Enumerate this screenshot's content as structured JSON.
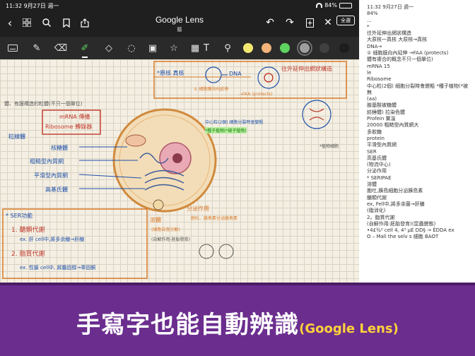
{
  "status_bar": {
    "time": "11:32  9月27日 週一",
    "battery": "84%",
    "battery_level": 0.84
  },
  "header": {
    "title": "Google Lens",
    "subtitle": "聽",
    "all_button": "全選"
  },
  "nav_icons": [
    "chevron-left-icon",
    "grid-icon",
    "search-icon",
    "bookmark-icon",
    "share-icon"
  ],
  "right_icons": [
    "undo-icon",
    "redo-icon",
    "add-page-icon",
    "close-icon",
    "more-icon"
  ],
  "tools": [
    "pen",
    "eraser",
    "highlighter",
    "shapes",
    "lasso",
    "image",
    "sticker",
    "text",
    "laser"
  ],
  "colors": {
    "swatches": [
      "#f3e970",
      "#f2b27a",
      "#5fd35f",
      "#9e9e9e",
      "#404040",
      "#1d1d1d"
    ],
    "selected": "#9e9e9e",
    "banner": "#6b2d8e",
    "accent": "#ffd23a"
  },
  "notes": {
    "top_title": "*原核  真核",
    "dna": "DNA",
    "red_title": "往外延伸出網狀構造",
    "sub_left": "① 細胞膜向內延伸",
    "sub_right": "→FAA (protects)",
    "left_heading": "體、有膜構造的粒體(不只一個單位)",
    "mrna": "mRNA 傳播",
    "ribosome": "Ribosome  轉錄器",
    "nucleus_heading": "中心粒(2個) 細胞分裂時會變粗",
    "green_line": "*種子植物(*被子植物)",
    "plant": "*植物細胞",
    "mitochondria_label": "粒線體",
    "ribosome_label": "核糖體",
    "er_label": "粗糙型內質網",
    "smooth_er_label": "平滑型內質網",
    "golgi_label": "高基氏體",
    "lysosome_label": "溶體",
    "phago": "分泌作用",
    "secrete_note": "胞吐、胰島素分泌胰島素",
    "ser_title": "* SER功能",
    "ser_1": "1. 醣類代謝",
    "ser_1_ex": "ex. 肝 cell中,將多余醣→肝醣",
    "ser_2": "2. 脂質代謝",
    "ser_2_ex": "ex. 性腺 cell中, 將膽固醇→睪固酮",
    "bottom_note": "(自解作用-胚胎發育)",
    "bottom_note2": "(細胞自我分解)"
  },
  "ocr": {
    "lines": [
      "11:32 9月27日 週一",
      "84%",
      "...",
      "*",
      "往外延伸出網狀構造",
      "大原核一真核 大原核→真核",
      "DNA→",
      "① 細胞膜向內延伸 →FAA (protects)",
      "體有複合的概念不只一個單位)",
      "mRNA 15",
      "le",
      "Ribosome",
      "中心粒(2個) 細胞分裂時會變粗 *種子植物(*被",
      "無",
      "(aa)",
      "胺基酸被糖體",
      "紡錘體) 拉染色體",
      "Profein 實溫",
      "20000 粗糙型內質網大",
      "多飲糖",
      "protein",
      "平滑型內質網",
      "SER",
      "高基氏體",
      "(物流中心)",
      "分泌作用",
      "* SERIPAE",
      "溶體",
      "胞吐,胰島細胞分泌胰島素",
      "醣類代謝",
      "ex, Fell中,將多余菌→肝醣",
      "(脂消化)",
      "2。脂質代謝",
      "(自解作用:胚胎發育)(昆蟲變態)",
      "•4£¾² cell 4, 4³ µÈ DD§ → ÊDDA ex",
      "O – Mall the selv s 細胞 BAOT"
    ]
  },
  "banner": {
    "main": "手寫字也能自動辨識",
    "paren": "(Google Lens)"
  }
}
